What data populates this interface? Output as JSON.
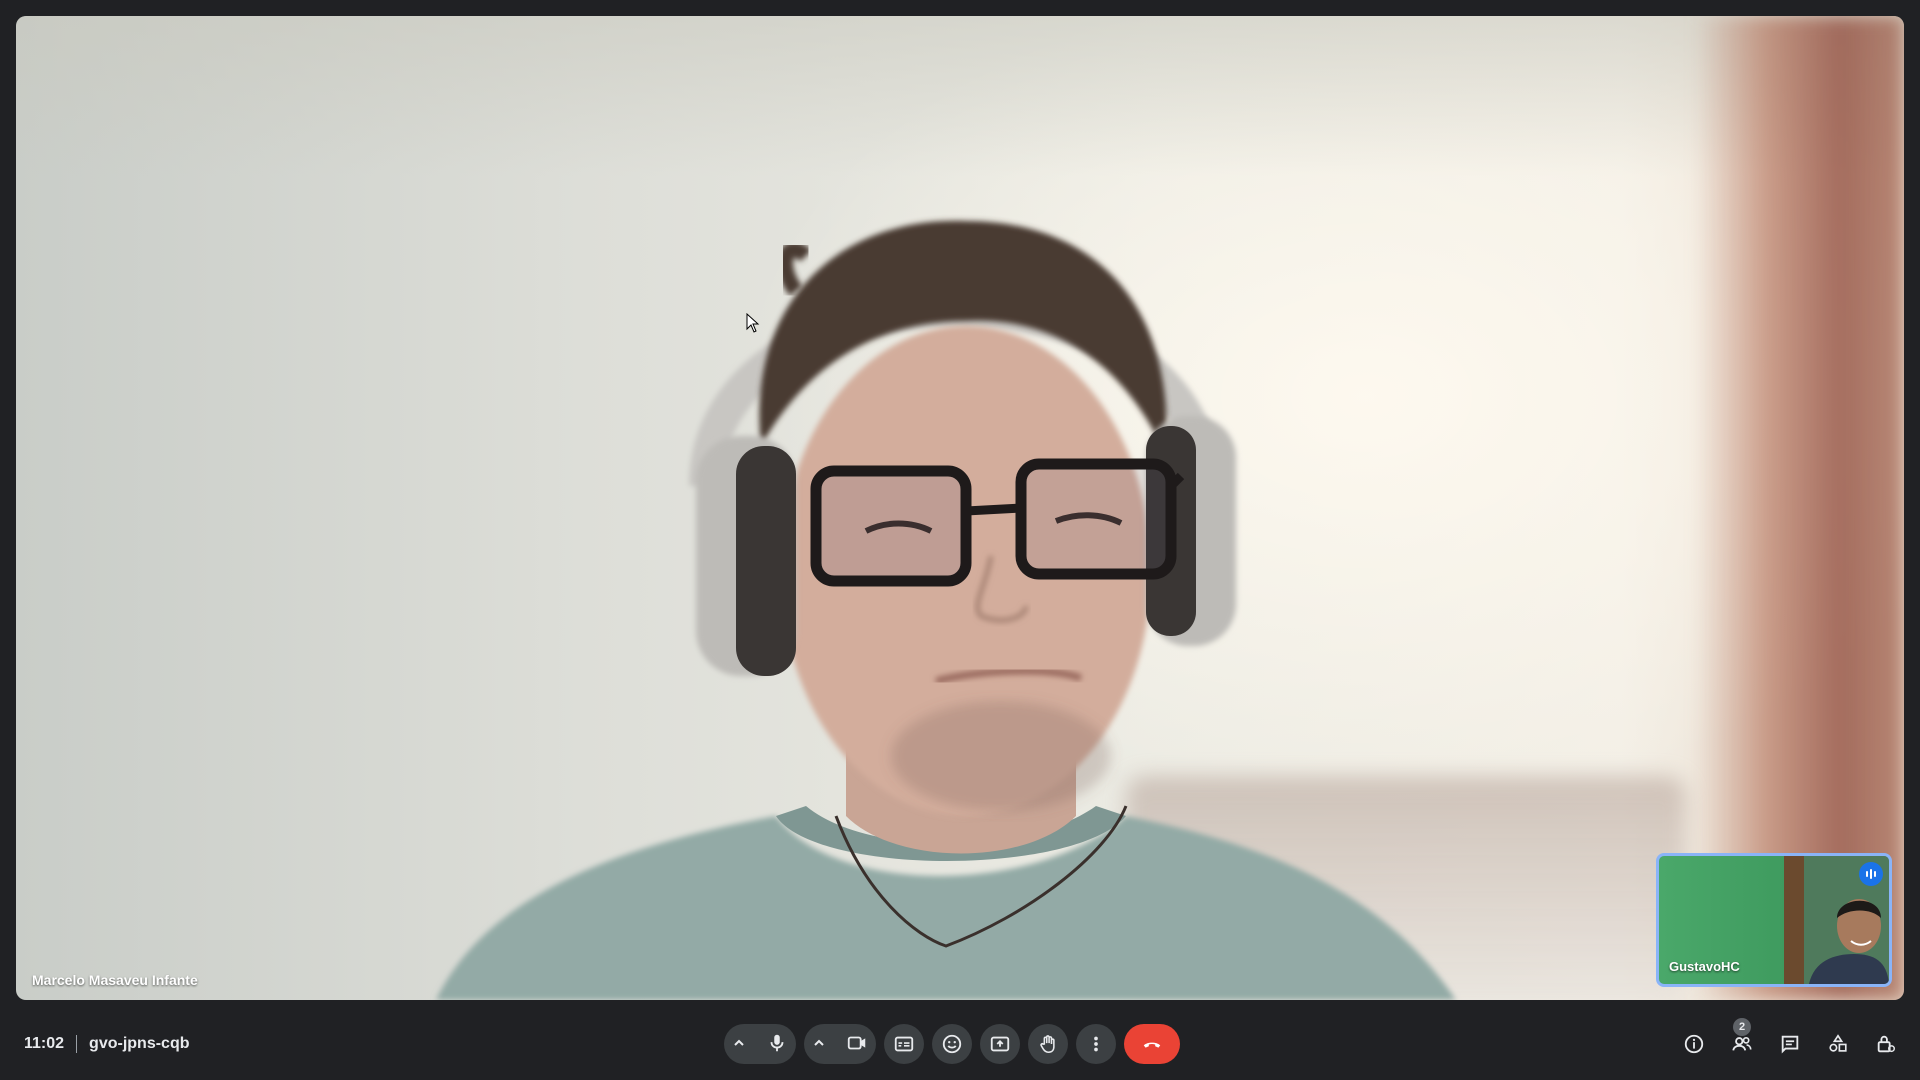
{
  "main_video": {
    "participant_name": "Marcelo Masaveu Infante"
  },
  "self_view": {
    "participant_name": "GustavoHC"
  },
  "meeting": {
    "time": "11:02",
    "code": "gvo-jpns-cqb"
  },
  "controls": [
    {
      "name": "microphone",
      "icon": "mic-icon",
      "has_options": true
    },
    {
      "name": "camera",
      "icon": "videocam-icon",
      "has_options": true
    },
    {
      "name": "captions",
      "icon": "closed-caption-icon"
    },
    {
      "name": "reactions",
      "icon": "emoji-icon"
    },
    {
      "name": "present",
      "icon": "present-screen-icon"
    },
    {
      "name": "raise-hand",
      "icon": "hand-icon"
    },
    {
      "name": "more-options",
      "icon": "more-vert-icon"
    },
    {
      "name": "leave-call",
      "icon": "call-end-icon",
      "color": "#ea4335"
    }
  ],
  "right_controls": {
    "people_count": "2",
    "items": [
      "info-icon",
      "people-icon",
      "chat-icon",
      "activities-icon",
      "host-controls-icon"
    ]
  },
  "colors": {
    "background": "#202124",
    "button": "#3c4043",
    "end_call": "#ea4335",
    "active_speaker": "#8ab4f8",
    "speaking_badge": "#1a73e8"
  }
}
